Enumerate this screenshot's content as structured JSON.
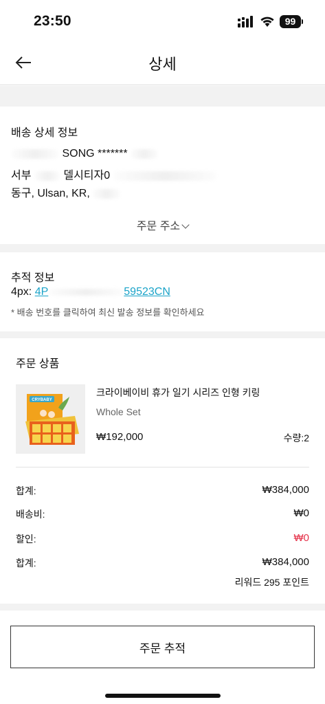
{
  "status_bar": {
    "time": "23:50",
    "battery": "99"
  },
  "header": {
    "title": "상세"
  },
  "shipping": {
    "title": "배송 상세 정보",
    "name_visible": "SONG *******",
    "address_line1_visible": "서부",
    "address_line1_visible2": "델시티자0",
    "address_line2_visible": "동구, Ulsan, KR,",
    "address_toggle": "주문 주소"
  },
  "tracking": {
    "title": "추적 정보",
    "carrier": "4px:",
    "number_visible_start": "4P",
    "number_visible_end": "59523CN",
    "note": "* 배송 번호를 클릭하여 최신 발송 정보를 확인하세요"
  },
  "order": {
    "title": "주문 상품",
    "product": {
      "name": "크라이베이비 휴가 일기 시리즈 인형 키링",
      "option": "Whole Set",
      "price": "₩192,000",
      "quantity": "수량:2",
      "thumb_icon": "product-box-image"
    },
    "summary": [
      {
        "label": "합계:",
        "value": "₩384,000",
        "color": "#111111"
      },
      {
        "label": "배송비:",
        "value": "₩0",
        "color": "#111111"
      },
      {
        "label": "할인:",
        "value": "₩0",
        "color": "#e5334b"
      },
      {
        "label": "합계:",
        "value": "₩384,000",
        "color": "#111111"
      }
    ],
    "reward": "리워드 295 포인트"
  },
  "footer": {
    "track_button": "주문 추적"
  }
}
